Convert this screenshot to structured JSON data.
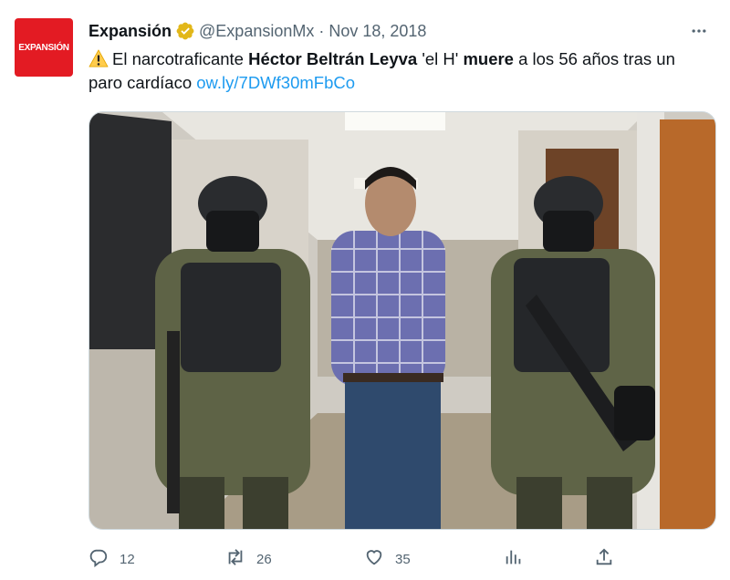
{
  "author": {
    "display_name": "Expansión",
    "handle": "@ExpansionMx",
    "separator": "·",
    "date": "Nov 18, 2018",
    "avatar_text": "EXPANSIÓN",
    "avatar_color": "#e31b23",
    "verified_badge": "gold-verified-badge-icon"
  },
  "tweet": {
    "warning_icon": "warning-icon",
    "t1": "El narcotraficante ",
    "t2": "Héctor Beltrán Leyva",
    "t3": " 'el H' ",
    "t4": "muere",
    "t5": " a los 56 años tras un paro cardíaco ",
    "link": "ow.ly/7DWf30mFbCo"
  },
  "media": {
    "description_icon": "photo"
  },
  "actions": {
    "replies": "12",
    "retweets": "26",
    "likes": "35"
  },
  "colors": {
    "link": "#1d9bf0",
    "muted": "#536471",
    "text": "#0f1419"
  }
}
